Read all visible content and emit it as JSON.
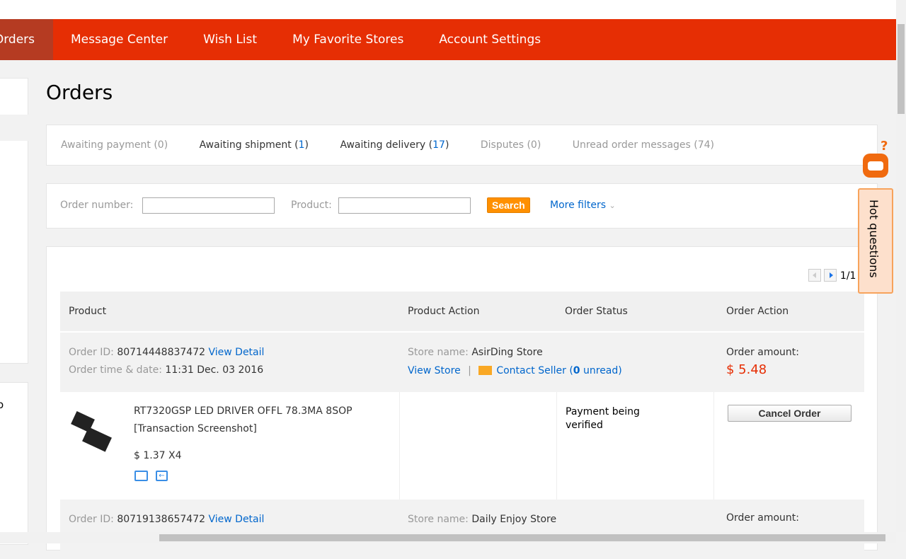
{
  "nav": {
    "items": [
      "Orders",
      "Message Center",
      "Wish List",
      "My Favorite Stores",
      "Account Settings"
    ],
    "active": 0
  },
  "page_title": "Orders",
  "tabs": [
    {
      "label": "Awaiting payment (0)"
    },
    {
      "pre": "Awaiting shipment (",
      "count": "1",
      "post": ")"
    },
    {
      "pre": "Awaiting delivery (",
      "count": "17",
      "post": ")"
    },
    {
      "label": "Disputes (0)"
    },
    {
      "label": "Unread order messages (74)"
    }
  ],
  "filters": {
    "order_number_label": "Order number:",
    "product_label": "Product:",
    "order_number_value": "",
    "product_value": "",
    "search_label": "Search",
    "more_filters": "More filters"
  },
  "pagination": "1/1",
  "table_headers": [
    "Product",
    "Product Action",
    "Order Status",
    "Order Action"
  ],
  "orders": [
    {
      "id_label": "Order ID:",
      "id": "80714448837472",
      "view_detail": "View Detail",
      "time_label": "Order time & date:",
      "time": "11:31 Dec. 03 2016",
      "store_label": "Store name:",
      "store": "AsirDing Store",
      "view_store": "View Store",
      "sep": "|",
      "contact": "Contact Seller (",
      "unread_count": "0",
      "unread_suffix": " unread)",
      "amount_label": "Order amount:",
      "amount": "$ 5.48",
      "product": "RT7320GSP LED DRIVER OFFL 78.3MA 8SOP",
      "screenshot": "[Transaction Screenshot]",
      "price": "$ 1.37 X4",
      "status": "Payment being verified",
      "action": "Cancel Order"
    },
    {
      "id_label": "Order ID:",
      "id": "80719138657472",
      "view_detail": "View Detail",
      "store_label": "Store name:",
      "store": "Daily Enjoy Store",
      "amount_label": "Order amount:"
    }
  ],
  "hot_questions": "Hot questions",
  "sidebar_partial": "o",
  "colors": {
    "brand": "#e62e04",
    "link": "#0066cc",
    "price": "#e62e04",
    "search": "#ff9000"
  }
}
